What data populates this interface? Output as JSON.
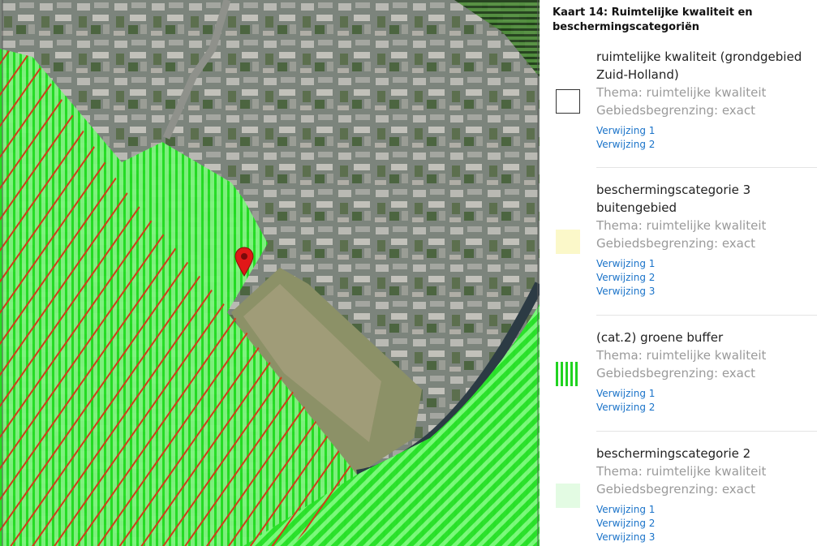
{
  "panel": {
    "title": "Kaart 14: Ruimtelijke kwaliteit en beschermingscategoriën"
  },
  "legend": [
    {
      "name": "ruimtelijke kwaliteit (grondgebied Zuid-Holland)",
      "theme": "Thema: ruimtelijke kwaliteit",
      "boundary": "Gebiedsbegrenzing: exact",
      "swatch": "outline",
      "refs": [
        "Verwijzing 1",
        "Verwijzing 2"
      ]
    },
    {
      "name": "beschermingscategorie 3 buitengebied",
      "theme": "Thema: ruimtelijke kwaliteit",
      "boundary": "Gebiedsbegrenzing: exact",
      "swatch": "light-yellow",
      "refs": [
        "Verwijzing 1",
        "Verwijzing 2",
        "Verwijzing 3"
      ]
    },
    {
      "name": "(cat.2) groene buffer",
      "theme": "Thema: ruimtelijke kwaliteit",
      "boundary": "Gebiedsbegrenzing: exact",
      "swatch": "green-stripes",
      "refs": [
        "Verwijzing 1",
        "Verwijzing 2"
      ]
    },
    {
      "name": "beschermingscategorie 2",
      "theme": "Thema: ruimtelijke kwaliteit",
      "boundary": "Gebiedsbegrenzing: exact",
      "swatch": "light-green",
      "refs": [
        "Verwijzing 1",
        "Verwijzing 2",
        "Verwijzing 3"
      ]
    }
  ],
  "colors": {
    "map_overlay_green": "#2ee82e",
    "map_overlay_red_hatch": "#d23a1a",
    "marker": "#e01818",
    "link": "#1a73c9"
  }
}
